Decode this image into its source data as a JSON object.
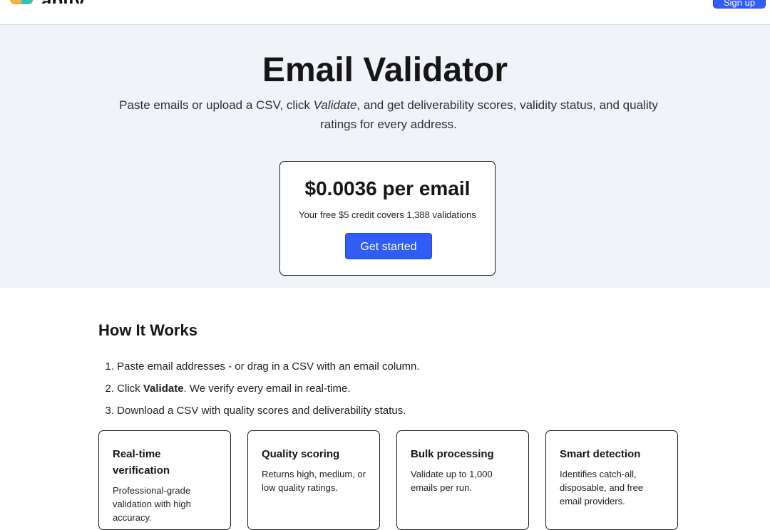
{
  "header": {
    "brand": "apify",
    "button_label": "Sign up"
  },
  "hero": {
    "title": "Email Validator",
    "subtitle_before": "Paste emails or upload a CSV, click ",
    "subtitle_emphasis": "Validate",
    "subtitle_after": ", and get deliverability scores, validity status, and quality ratings for every address."
  },
  "pricing": {
    "price": "$0.0036 per email",
    "note": "Your free $5 credit covers 1,388 validations",
    "cta_label": "Get started"
  },
  "how_it_works": {
    "title": "How It Works",
    "steps": [
      {
        "num": "1.",
        "text": "Paste email addresses - or drag in a CSV with an email column."
      },
      {
        "num": "2.",
        "before": "Click ",
        "bold": "Validate",
        "after": ". We verify every email in real-time."
      },
      {
        "num": "3.",
        "text": "Download a CSV with quality scores and deliverability status."
      }
    ]
  },
  "features": [
    {
      "title": "Real-time verification",
      "desc": "Professional-grade validation with high accuracy."
    },
    {
      "title": "Quality scoring",
      "desc": "Returns high, medium, or low quality ratings."
    },
    {
      "title": "Bulk processing",
      "desc": "Validate up to 1,000 emails per run."
    },
    {
      "title": "Smart detection",
      "desc": "Identifies catch-all, disposable, and free email providers."
    }
  ],
  "colors": {
    "accent": "#2f5df5",
    "hero_bg": "#f0f3f8"
  }
}
